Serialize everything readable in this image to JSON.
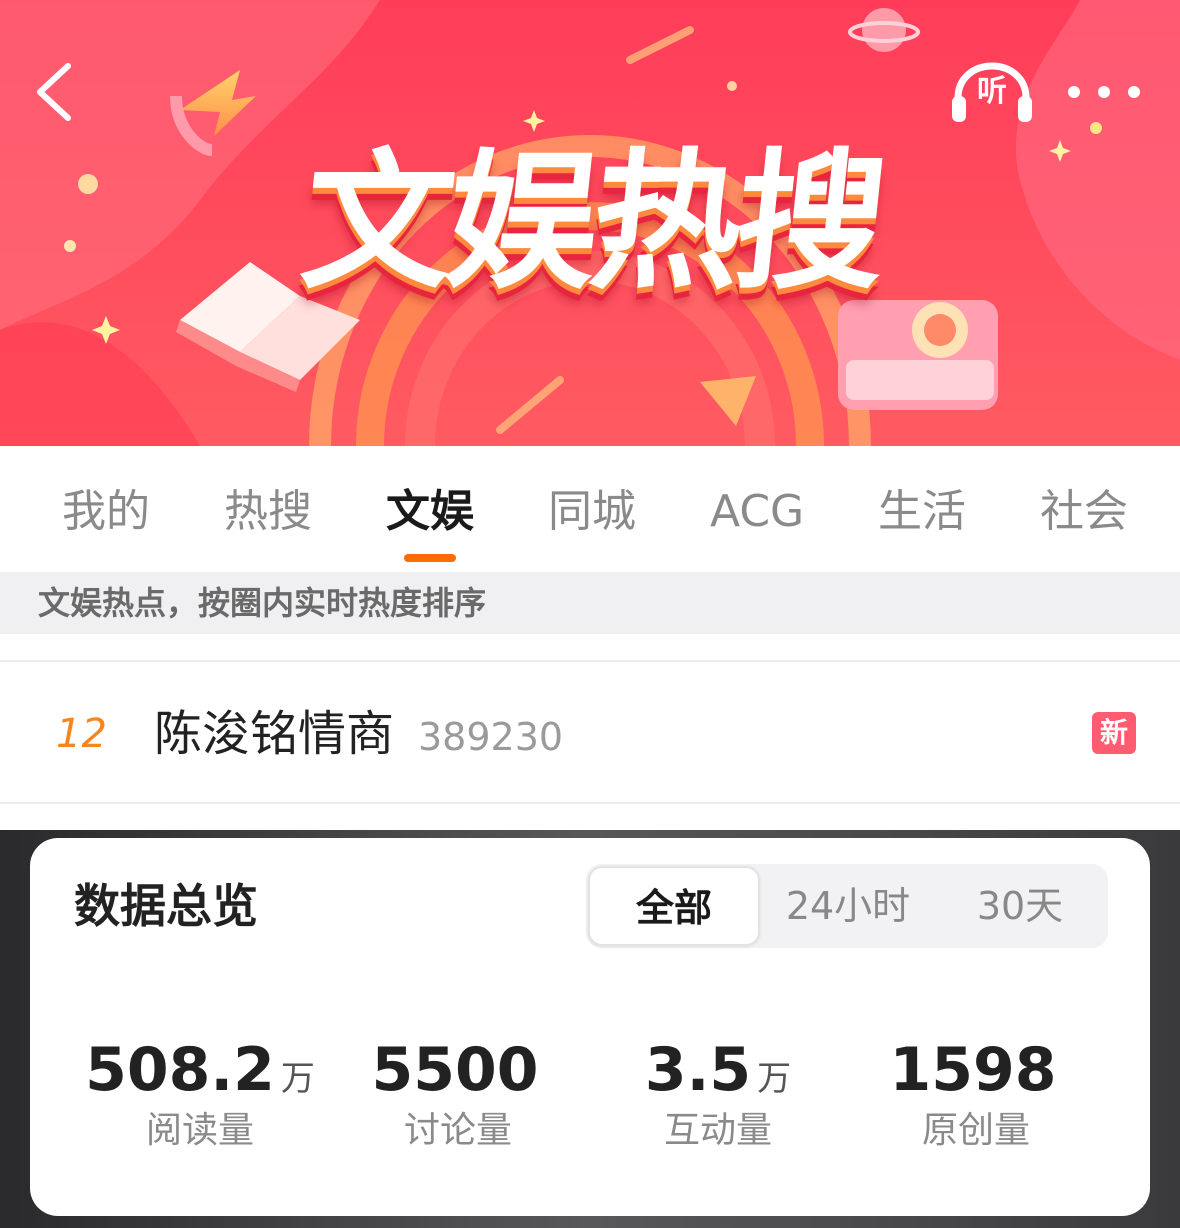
{
  "banner": {
    "title": "文娱热搜",
    "listen_label": "听"
  },
  "tabs": [
    {
      "label": "我的",
      "active": false
    },
    {
      "label": "热搜",
      "active": false
    },
    {
      "label": "文娱",
      "active": true
    },
    {
      "label": "同城",
      "active": false
    },
    {
      "label": "ACG",
      "active": false
    },
    {
      "label": "生活",
      "active": false
    },
    {
      "label": "社会",
      "active": false
    }
  ],
  "subheader": "文娱热点，按圈内实时热度排序",
  "list": [
    {
      "rank": "12",
      "title": "陈浚铭情商",
      "count": "389230",
      "badge": "新"
    }
  ],
  "overview": {
    "title": "数据总览",
    "segments": [
      {
        "label": "全部",
        "active": true
      },
      {
        "label": "24小时",
        "active": false
      },
      {
        "label": "30天",
        "active": false
      }
    ],
    "stats": [
      {
        "value": "508.2",
        "unit": "万",
        "label": "阅读量"
      },
      {
        "value": "5500",
        "unit": "",
        "label": "讨论量"
      },
      {
        "value": "3.5",
        "unit": "万",
        "label": "互动量"
      },
      {
        "value": "1598",
        "unit": "",
        "label": "原创量"
      }
    ]
  },
  "colors": {
    "accent": "#ff6a0a",
    "rank": "#f5861f",
    "badge": "#ff5c72",
    "banner": "#ff4a5c"
  }
}
